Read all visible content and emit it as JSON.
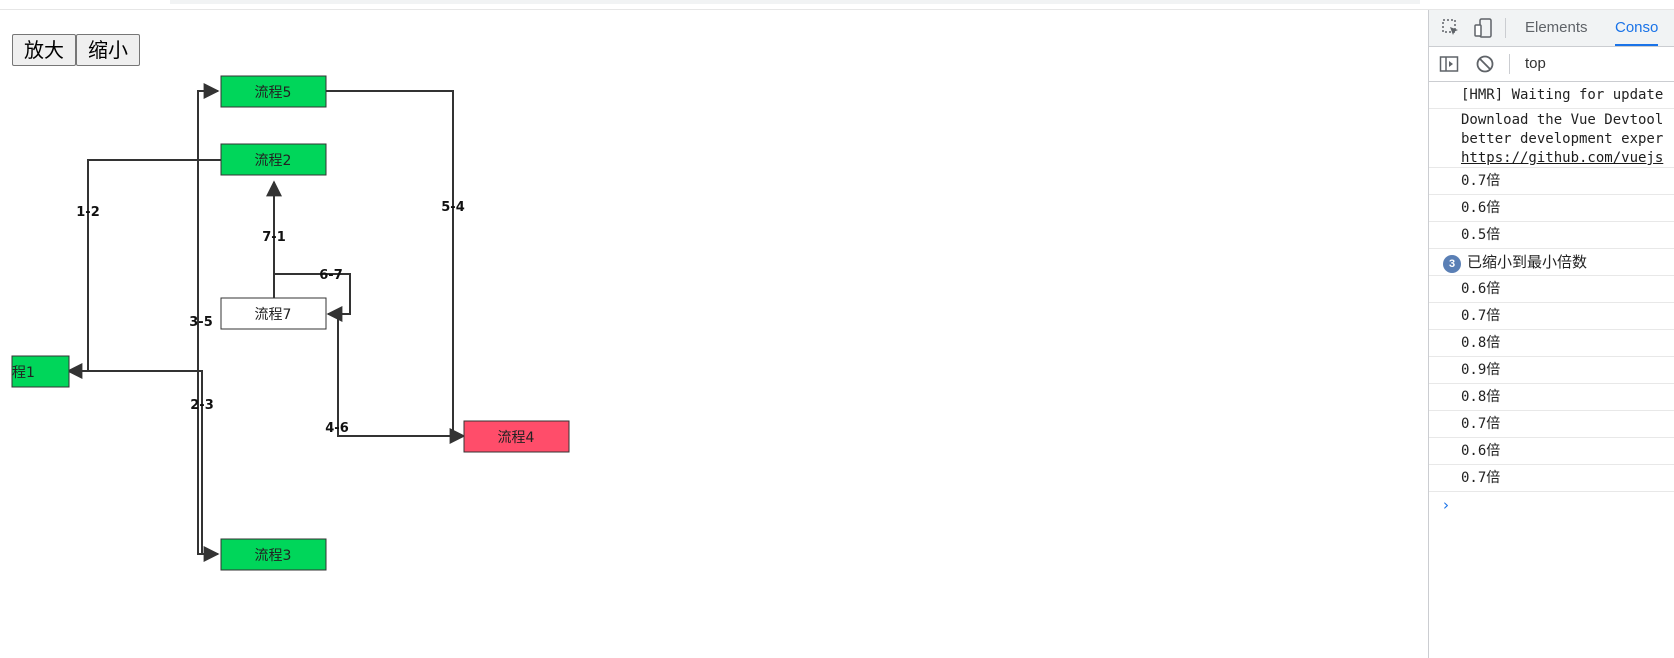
{
  "toolbar": {
    "zoom_in_label": "放大",
    "zoom_out_label": "缩小"
  },
  "diagram": {
    "nodes": {
      "n5": {
        "label": "流程5",
        "color": "#00d65a"
      },
      "n2": {
        "label": "流程2",
        "color": "#00d65a"
      },
      "n7": {
        "label": "流程7",
        "color": "#ffffff"
      },
      "n1": {
        "label": "程1",
        "color": "#00d65a"
      },
      "n3": {
        "label": "流程3",
        "color": "#00d65a"
      },
      "n4": {
        "label": "流程4",
        "color": "#ff4d6a"
      }
    },
    "edges": {
      "e12": "1-2",
      "e54": "5-4",
      "e71": "7-1",
      "e67": "6-7",
      "e35": "3-5",
      "e23": "2-3",
      "e46": "4-6"
    }
  },
  "devtools": {
    "tabs": {
      "elements": "Elements",
      "console": "Conso"
    },
    "context": "top",
    "icons": [
      "inspect-icon",
      "device-toggle-icon",
      "sidebar-toggle-icon",
      "clear-console-icon"
    ],
    "accent_color": "#1a73e8",
    "messages": {
      "hmr": "[HMR] Waiting for update",
      "vue1": "Download the Vue Devtool",
      "vue2": "better development exper",
      "vue3": "https://github.com/vuejs",
      "m1": "0.7倍",
      "m2": "0.6倍",
      "m3": "0.5倍",
      "grouped_count": "3",
      "grouped": "已缩小到最小倍数",
      "m4": "0.6倍",
      "m5": "0.7倍",
      "m6": "0.8倍",
      "m7": "0.9倍",
      "m8": "0.8倍",
      "m9": "0.7倍",
      "m10": "0.6倍",
      "m11": "0.7倍"
    }
  }
}
